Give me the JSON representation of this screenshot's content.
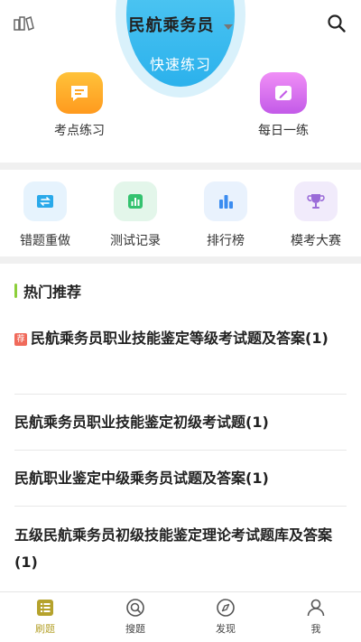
{
  "header": {
    "title": "民航乘务员",
    "left_icon": "book-stack-icon",
    "right_icon": "search-icon"
  },
  "quick_practice": {
    "label": "快速练习"
  },
  "top_tiles": [
    {
      "label": "考点练习",
      "icon": "notes-icon",
      "color": "#ffa726"
    },
    {
      "label": "每日一练",
      "icon": "pencil-icon",
      "color": "#d36cf0"
    }
  ],
  "small_tiles": [
    {
      "label": "错题重做",
      "icon": "swap-icon"
    },
    {
      "label": "测试记录",
      "icon": "bar-chart-icon"
    },
    {
      "label": "排行榜",
      "icon": "ranking-icon"
    },
    {
      "label": "模考大赛",
      "icon": "trophy-icon"
    }
  ],
  "hot": {
    "title": "热门推荐",
    "badge": "荐",
    "items": [
      "民航乘务员职业技能鉴定等级考试题及答案(1)",
      "民航乘务员职业技能鉴定初级考试题(1)",
      "民航职业鉴定中级乘务员试题及答案(1)",
      "五级民航乘务员初级技能鉴定理论考试题库及答案(1)"
    ]
  },
  "bottom_nav": [
    {
      "label": "刷题",
      "icon": "list-icon",
      "active": true
    },
    {
      "label": "搜题",
      "icon": "search-circle-icon",
      "active": false
    },
    {
      "label": "发现",
      "icon": "compass-icon",
      "active": false
    },
    {
      "label": "我",
      "icon": "user-icon",
      "active": false
    }
  ],
  "colors": {
    "accent": "#2bb1ec",
    "active_tab": "#b5a22c",
    "section_bar": "#8ccf3a"
  }
}
